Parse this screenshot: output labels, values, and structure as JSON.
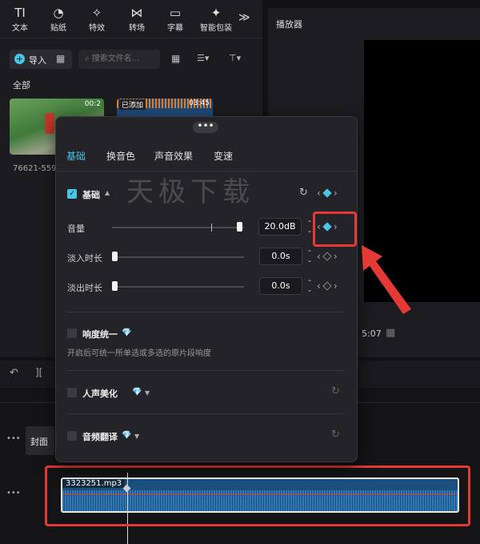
{
  "toolbar": {
    "items": [
      {
        "label": "文本",
        "icon": "text-icon",
        "glyph": "TI"
      },
      {
        "label": "贴纸",
        "icon": "sticker-icon",
        "glyph": "◔"
      },
      {
        "label": "特效",
        "icon": "effects-icon",
        "glyph": "✧"
      },
      {
        "label": "转场",
        "icon": "transition-icon",
        "glyph": "⋈"
      },
      {
        "label": "字幕",
        "icon": "subtitle-icon",
        "glyph": "▭"
      },
      {
        "label": "智能包装",
        "icon": "smart-package-icon",
        "glyph": "✦"
      }
    ],
    "more": "≫"
  },
  "media": {
    "import_label": "导入",
    "search_placeholder": "搜索文件名...",
    "all_label": "全部",
    "thumb1_name": "76621-559",
    "thumb2_badge": "已添加",
    "thumb2_duration": "03:45",
    "thumb1_time": "00:2"
  },
  "player": {
    "title": "播放器",
    "timecode": "5:07"
  },
  "popup": {
    "handle": "•••",
    "tabs": [
      "基础",
      "换音色",
      "声音效果",
      "变速"
    ],
    "section_basic": "基础",
    "volume_label": "音量",
    "volume_value": "20.0dB",
    "volume_fraction": 0.97,
    "fadein_label": "淡入时长",
    "fadein_value": "0.0s",
    "fadeout_label": "淡出时长",
    "fadeout_value": "0.0s",
    "loudness_label": "响度统一",
    "loudness_desc": "开启后可统一所单选或多选的原片段响度",
    "voice_beautify_label": "人声美化",
    "audio_translate_label": "音频翻译",
    "watermark": "天极下载"
  },
  "timeline": {
    "cover_label": "封面",
    "audio_clip_name": "3323251.mp3"
  },
  "colors": {
    "accent": "#47c6e8",
    "highlight": "#e53935"
  }
}
